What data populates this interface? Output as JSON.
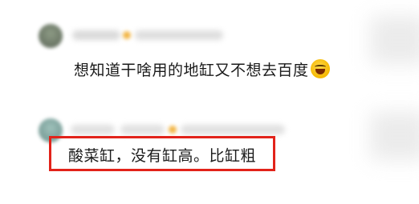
{
  "comments": [
    {
      "text": "想知道干啥用的地缸又不想去百度",
      "emoji": "rolling-laughing-emoji"
    },
    {
      "text": "酸菜缸，没有缸高。比缸粗",
      "highlighted": true
    }
  ],
  "colors": {
    "highlight_border": "#e2231a",
    "text": "#1a1a1a"
  }
}
